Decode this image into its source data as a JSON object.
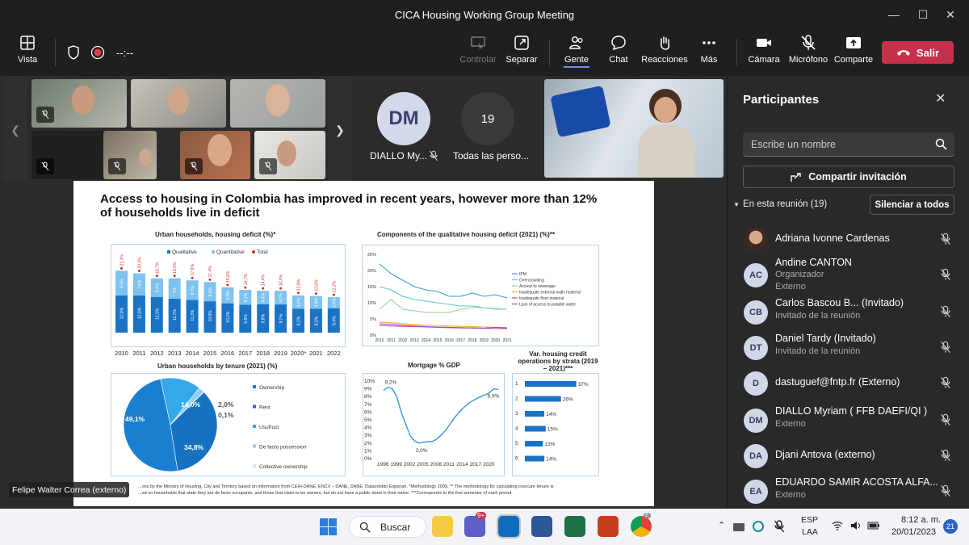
{
  "window": {
    "title": "CICA Housing Working Group Meeting"
  },
  "toolbar": {
    "vista": "Vista",
    "timer": "--:--",
    "controlar": "Controlar",
    "separar": "Separar",
    "gente": "Gente",
    "chat": "Chat",
    "reacciones": "Reacciones",
    "mas": "Más",
    "camara": "Cámara",
    "microfono": "Micrófono",
    "comparte": "Comparte",
    "salir": "Salir"
  },
  "stage": {
    "dm_initials": "DM",
    "dm_name": "DIALLO My...",
    "count": "19",
    "count_label": "Todas las perso...",
    "speaker_label": "Felipe Walter Correa (externo)"
  },
  "slide": {
    "title_line1": "Access to housing in Colombia has improved in recent years, however more than 12%",
    "title_line2": "of households live in deficit",
    "footnote_line1": "...ons by the Ministry of Housing, City and Territory based on information from CEIH-DANE, ENCV – DANE, DANE, Datacrédito Experian. *Methodology 2009. ** The methodology for calculating insecure tenure is",
    "footnote_line2": "...ed on households that state they are de facto occupants, and those that claim to be owners, but do not have a public deed in their name. ***Corresponds to the first semester of each period."
  },
  "chart_data": [
    {
      "type": "bar",
      "title": "Urban households, housing deficit (%)*",
      "legend": [
        "Qualitative",
        "Quantitative",
        "Total"
      ],
      "categories": [
        "2010",
        "2011",
        "2012",
        "2013",
        "2014",
        "2015",
        "2016",
        "2017",
        "2018",
        "2019",
        "2020*",
        "2021",
        "2022"
      ],
      "series": [
        {
          "name": "Qualitative",
          "values": [
            12.8,
            12.8,
            12.3,
            11.7,
            11.3,
            10.8,
            10.1,
            9.6,
            9.8,
            9.7,
            8.2,
            8.2,
            8.4
          ]
        },
        {
          "name": "Quantitative",
          "values": [
            8.5,
            7.6,
            6.4,
            7.0,
            6.7,
            6.6,
            5.5,
            5.1,
            4.6,
            4.7,
            4.6,
            4.4,
            3.8
          ]
        }
      ],
      "totals": [
        21.3,
        20.3,
        18.7,
        18.6,
        17.9,
        17.4,
        15.6,
        14.7,
        14.4,
        14.4,
        12.8,
        12.6,
        12.2
      ],
      "colors": {
        "qualitative": "#1b73c5",
        "quantitative": "#7ec3ee",
        "total": "#c0392b"
      }
    },
    {
      "type": "line",
      "title": "Components of the qualitative housing deficit (2021) (%)**",
      "x": [
        "2010",
        "2011",
        "2012",
        "2013",
        "2014",
        "2015",
        "2016",
        "2017",
        "2018",
        "2019",
        "2020",
        "2021"
      ],
      "ylim": [
        0,
        25
      ],
      "yticks": [
        "0%",
        "5%",
        "10%",
        "15%",
        "20%",
        "25%"
      ],
      "series": [
        {
          "name": "IPM",
          "color": "#3a9ad9",
          "values": [
            22,
            19,
            17,
            15,
            14,
            13.5,
            12,
            12,
            13,
            12,
            12.5,
            11.5
          ]
        },
        {
          "name": "Overcrowding",
          "color": "#56c8d8",
          "values": [
            15,
            14,
            12,
            11,
            10.5,
            10,
            9.5,
            9,
            9,
            8.5,
            8.2,
            8
          ]
        },
        {
          "name": "Access to sewerage",
          "color": "#8fd694",
          "values": [
            8,
            11,
            8,
            7.5,
            7,
            7,
            7,
            8,
            8.5,
            8.5,
            8,
            8
          ]
        },
        {
          "name": "Inadequate external walls material",
          "color": "#f0a830",
          "values": [
            4,
            3.8,
            3.5,
            3.3,
            3,
            3,
            2.8,
            2.7,
            2.6,
            2.5,
            2.4,
            2.3
          ]
        },
        {
          "name": "Inadequate floor material",
          "color": "#d94e8f",
          "values": [
            3,
            2.8,
            2.7,
            2.6,
            2.5,
            2.4,
            2.3,
            2.2,
            2.2,
            2.1,
            2,
            2
          ]
        },
        {
          "name": "Lack of access to potable water",
          "color": "#7a5cc7",
          "values": [
            3.5,
            3.3,
            3,
            2.8,
            2.6,
            2.5,
            2.4,
            2.3,
            2.2,
            2.1,
            2.4,
            2.2
          ]
        }
      ]
    },
    {
      "type": "pie",
      "title": "Urban households by tenure (2021) (%)",
      "slices": [
        {
          "name": "Ownership",
          "value": 49.1,
          "label": "49,1%",
          "color": "#1b7fd1"
        },
        {
          "name": "Rent",
          "value": 34.8,
          "label": "34,8%",
          "color": "#1672c0"
        },
        {
          "name": "Usufruct",
          "value": 14.0,
          "label": "14,0%",
          "color": "#35a8e8"
        },
        {
          "name": "De facto possession",
          "value": 2.0,
          "label": "2,0%",
          "color": "#8fd0f2"
        },
        {
          "name": "Collective ownership",
          "value": 0.1,
          "label": "0,1%",
          "color": "#cfe9f8"
        }
      ]
    },
    {
      "type": "line",
      "title": "Mortgage % GDP",
      "xticks": [
        "1996",
        "1999",
        "2002",
        "2005",
        "2008",
        "2011",
        "2014",
        "2017",
        "2020"
      ],
      "ylim": [
        0,
        10
      ],
      "yticks": [
        "0%",
        "1%",
        "2%",
        "3%",
        "4%",
        "5%",
        "6%",
        "7%",
        "8%",
        "9%",
        "10%"
      ],
      "x": [
        1996,
        1997,
        1998,
        1999,
        2000,
        2001,
        2002,
        2003,
        2004,
        2005,
        2006,
        2007,
        2008,
        2009,
        2010,
        2011,
        2012,
        2013,
        2014,
        2015,
        2016,
        2017,
        2018,
        2019,
        2020,
        2021,
        2022
      ],
      "values": [
        8.8,
        9.2,
        9.0,
        8.0,
        6.0,
        4.5,
        3.0,
        2.3,
        2.0,
        2.1,
        2.2,
        2.2,
        2.5,
        3.0,
        3.6,
        4.4,
        5.2,
        5.9,
        6.5,
        7.0,
        7.4,
        7.7,
        8.0,
        8.2,
        8.5,
        9.0,
        8.9
      ],
      "annotations": [
        "9,2%",
        "2,0%",
        "8,9%"
      ],
      "color": "#3a9ad9"
    },
    {
      "type": "bar",
      "title": "Var. housing credit operations by strata (2019 – 2021)***",
      "categories": [
        "1",
        "2",
        "3",
        "4",
        "5",
        "6"
      ],
      "values": [
        37,
        26,
        14,
        15,
        13,
        14
      ],
      "labels": [
        "37%",
        "26%",
        "14%",
        "15%",
        "13%",
        "14%"
      ],
      "color": "#1b73c5"
    }
  ],
  "panel": {
    "title": "Participantes",
    "search_placeholder": "Escribe un nombre",
    "share": "Compartir invitación",
    "section": "En esta reunión (19)",
    "mute_all": "Silenciar a todos",
    "participants": [
      {
        "initials": "",
        "name": "Adriana Ivonne Cardenas",
        "sub": "",
        "sub2": ""
      },
      {
        "initials": "AC",
        "name": "Andine CANTON",
        "sub": "Organizador",
        "sub2": "Externo"
      },
      {
        "initials": "CB",
        "name": "Carlos Bascou B...   (Invitado)",
        "sub": "Invitado de la reunión",
        "sub2": ""
      },
      {
        "initials": "DT",
        "name": "Daniel Tardy (Invitado)",
        "sub": "Invitado de la reunión",
        "sub2": ""
      },
      {
        "initials": "D",
        "name": "dastuguef@fntp.fr (Externo)",
        "sub": "",
        "sub2": ""
      },
      {
        "initials": "DM",
        "name": "DIALLO Myriam ( FFB DAEFI/QI )",
        "sub": "Externo",
        "sub2": ""
      },
      {
        "initials": "DA",
        "name": "Djani Antova (externo)",
        "sub": "",
        "sub2": ""
      },
      {
        "initials": "EA",
        "name": "EDUARDO SAMIR ACOSTA ALFA...",
        "sub": "Externo",
        "sub2": ""
      }
    ]
  },
  "taskbar": {
    "search": "Buscar",
    "teams_badge": "9+",
    "chrome_badge": "E",
    "lang1": "ESP",
    "lang2": "LAA",
    "time": "8:12 a. m.",
    "date": "20/01/2023",
    "notif": "21"
  }
}
